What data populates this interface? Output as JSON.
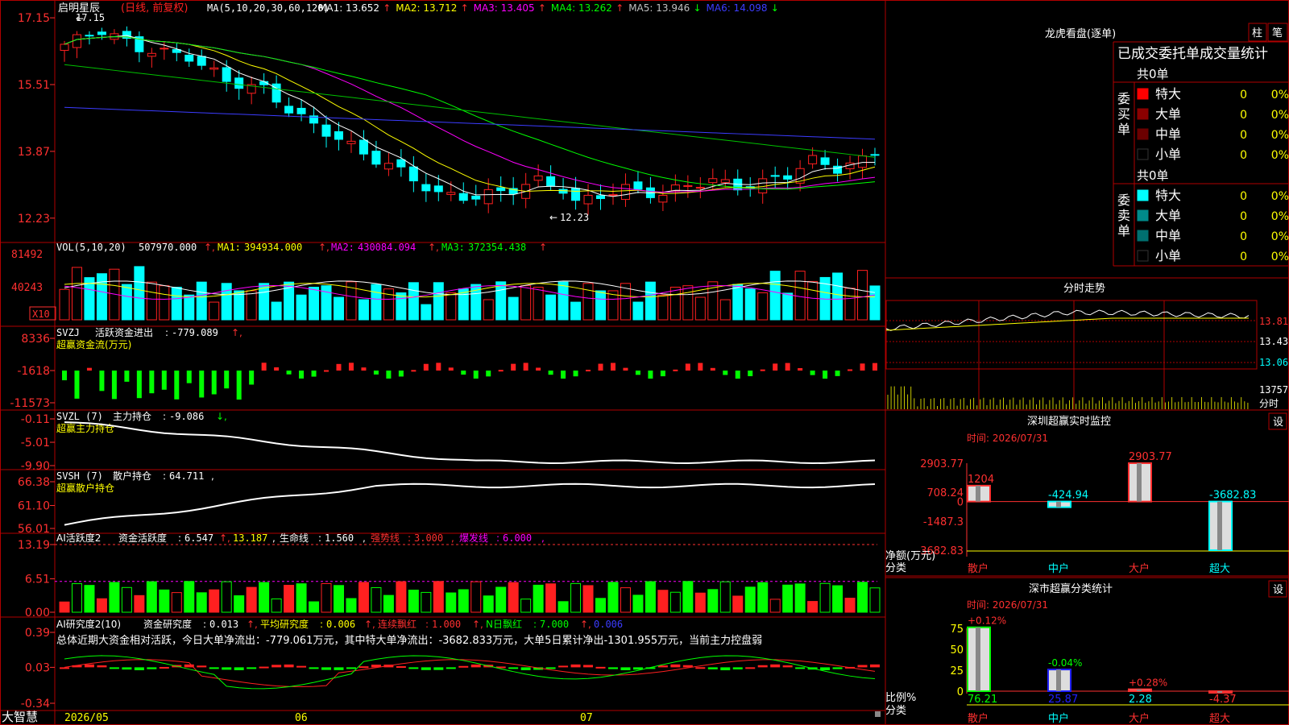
{
  "chart_data": {
    "type": "candlestick",
    "title": "启明星辰",
    "subtitle": "(日线, 前复权)",
    "ma_label": "MA(5,10,20,30,60,120)",
    "ma_values": [
      {
        "name": "MA1",
        "value": "13.652",
        "dir": "↑",
        "color": "#ffffff"
      },
      {
        "name": "MA2",
        "value": "13.712",
        "dir": "↑",
        "color": "#ffff00"
      },
      {
        "name": "MA3",
        "value": "13.405",
        "dir": "↑",
        "color": "#ff00ff"
      },
      {
        "name": "MA4",
        "value": "13.262",
        "dir": "↑",
        "color": "#00ff00"
      },
      {
        "name": "MA5",
        "value": "13.946",
        "dir": "↓",
        "color": "#c0c0c0"
      },
      {
        "name": "MA6",
        "value": "14.098",
        "dir": "↓",
        "color": "#3c3cff"
      }
    ],
    "price_axis": {
      "ticks": [
        "17.15",
        "15.51",
        "13.87",
        "12.23"
      ],
      "ylim": [
        11.85,
        17.35
      ]
    },
    "annotations": {
      "high": "17.15",
      "low": "12.23"
    },
    "x_labels": [
      "2026/05",
      "06",
      "07"
    ],
    "volume": {
      "title": "VOL(5,10,20)",
      "value": "507970.000",
      "ma1": "394934.000",
      "ma2": "430084.094",
      "ma3": "372354.438",
      "ticks": [
        "81492",
        "40243"
      ],
      "unit": "X10",
      "ylim": [
        0,
        90000
      ]
    },
    "svzj": {
      "title": "SVZJ",
      "label": "活跃资金进出",
      "value": "-779.089",
      "subtitle": "超赢资金流(万元)",
      "ticks": [
        "8336",
        "-1618",
        "-11573"
      ],
      "ylim": [
        -11573,
        8336
      ]
    },
    "svzl": {
      "title": "SVZL (7)",
      "label": "主力持仓",
      "value": "-9.086",
      "subtitle": "超赢主力持仓",
      "ticks": [
        "-0.11",
        "-5.01",
        "-9.90"
      ],
      "ylim": [
        -9.9,
        -0.11
      ]
    },
    "svsh": {
      "title": "SVSH (7)",
      "label": "散户持仓",
      "value": "64.711",
      "subtitle": "超赢散户持仓",
      "ticks": [
        "66.38",
        "61.10",
        "56.01"
      ],
      "ylim": [
        56.01,
        66.38
      ]
    },
    "ai_active": {
      "title": "AI活跃度2",
      "label": "资金活跃度",
      "value": "6.547",
      "value2": "13.187",
      "life_label": "生命线",
      "life_value": "1.560",
      "strong_label": "强势线",
      "strong_value": "3.000",
      "burst_label": "爆发线",
      "burst_value": "6.000",
      "ticks": [
        "13.19",
        "6.51",
        "0.00"
      ],
      "ylim": [
        0,
        13.19
      ]
    },
    "ai_research": {
      "title": "AI研究度2(10)",
      "label": "资金研究度",
      "value": "0.013",
      "avg_label": "平均研究度",
      "avg_value": "0.006",
      "red_label": "连续飘红",
      "red_value": "1.000",
      "nred_label": "N日飘红",
      "nred_value": "7.000",
      "extra_value": "0.006",
      "summary": "总体近期大资金相对活跃，今日大单净流出：-779.061万元，其中特大单净流出：-3682.833万元，大单5日累计净出-1301.955万元，当前主力控盘弱",
      "ticks": [
        "0.39",
        "0.03",
        "-0.34"
      ],
      "ylim": [
        -0.34,
        0.39
      ]
    }
  },
  "footer": {
    "brand": "大智慧"
  },
  "right_panel": {
    "header": {
      "title": "龙虎看盘(逐单)",
      "btn_bar": "柱",
      "btn_stroke": "笔"
    },
    "order_stats": {
      "title": "已成交委托单成交量统计",
      "buy": {
        "side_label": "委买单",
        "total": "共0单",
        "rows": [
          {
            "label": "特大",
            "count": "0",
            "pct": "0%",
            "color": "#ff0000"
          },
          {
            "label": "大单",
            "count": "0",
            "pct": "0%",
            "color": "#8b0000"
          },
          {
            "label": "中单",
            "count": "0",
            "pct": "0%",
            "color": "#6b0000"
          },
          {
            "label": "小单",
            "count": "0",
            "pct": "0%",
            "color": "#000000"
          }
        ]
      },
      "sell": {
        "side_label": "委卖单",
        "total": "共0单",
        "rows": [
          {
            "label": "特大",
            "count": "0",
            "pct": "0%",
            "color": "#00ffff"
          },
          {
            "label": "大单",
            "count": "0",
            "pct": "0%",
            "color": "#008b8b"
          },
          {
            "label": "中单",
            "count": "0",
            "pct": "0%",
            "color": "#007070"
          },
          {
            "label": "小单",
            "count": "0",
            "pct": "0%",
            "color": "#000000"
          }
        ]
      }
    },
    "intraday": {
      "title": "分时走势",
      "ticks": [
        "13.81",
        "13.43",
        "13.06"
      ],
      "vol_tick": "13757",
      "vol_label": "分时"
    },
    "monitor": {
      "title": "深圳超赢实时监控",
      "btn": "设",
      "time": "时间: 2026/07/31",
      "y_label": "净额(万元)",
      "x_label": "分类",
      "ticks": [
        "2903.77",
        "708.24",
        "0",
        "-1487.3",
        "-3682.83"
      ],
      "bars": [
        {
          "cat": "散户",
          "value": 1204,
          "label": "1204"
        },
        {
          "cat": "中户",
          "value": -424.94,
          "label": "-424.94"
        },
        {
          "cat": "大户",
          "value": 2903.77,
          "label": "2903.77"
        },
        {
          "cat": "超大",
          "value": -3682.83,
          "label": "-3682.83"
        }
      ]
    },
    "classify": {
      "title": "深市超赢分类统计",
      "btn": "设",
      "time": "时间: 2026/07/31",
      "y_label": "比例%",
      "x_label": "分类",
      "ticks": [
        "75",
        "50",
        "25",
        "0"
      ],
      "bars": [
        {
          "cat": "散户",
          "value": 76.21,
          "label": "76.21",
          "delta": "+0.12%"
        },
        {
          "cat": "中户",
          "value": 25.87,
          "label": "25.87",
          "delta": "-0.04%"
        },
        {
          "cat": "大户",
          "value": 2.28,
          "label": "2.28",
          "delta": "+0.28%"
        },
        {
          "cat": "超大",
          "value": -4.37,
          "label": "-4.37",
          "delta": ""
        }
      ]
    }
  },
  "colors": {
    "bg": "#000000",
    "grid": "#b00000",
    "up": "#ff2020",
    "down": "#00ffff",
    "label": "#ffff00",
    "axis_text": "#ff3030",
    "text": "#ffffff"
  }
}
